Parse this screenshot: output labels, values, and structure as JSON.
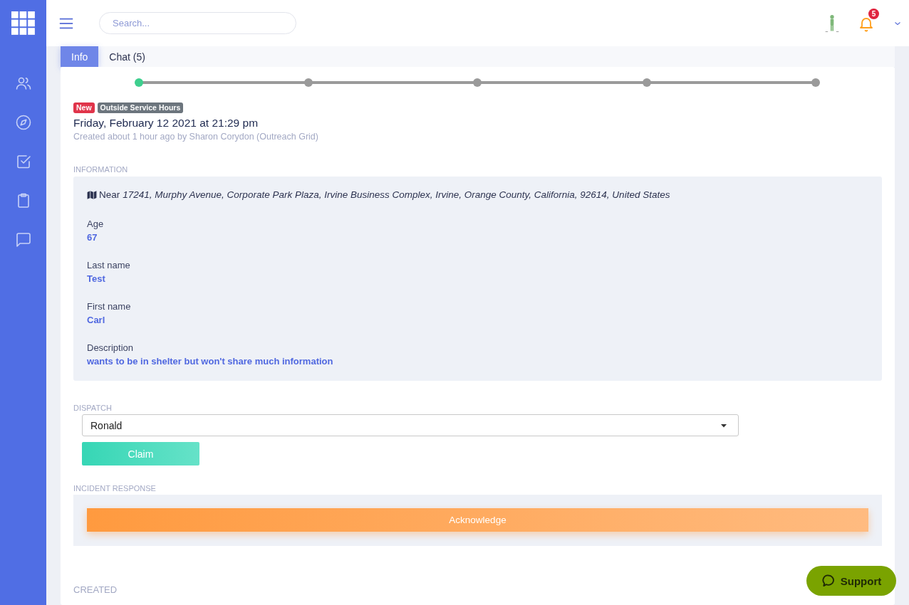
{
  "topbar": {
    "search": {
      "placeholder": "Search..."
    },
    "notifications": {
      "count": "5"
    }
  },
  "tabs": [
    {
      "label": "Info",
      "selected": true
    },
    {
      "label": "Chat (5)",
      "selected": false
    }
  ],
  "progress": {
    "steps": [
      {
        "completed": true
      },
      {
        "completed": false
      },
      {
        "completed": false
      },
      {
        "completed": false
      },
      {
        "completed": false
      }
    ]
  },
  "badges": [
    {
      "label": "New",
      "color": "#e0344a"
    },
    {
      "label": "Outside Service Hours",
      "color": "#6c757d"
    }
  ],
  "title": "Friday, February 12 2021 at 21:29 pm",
  "subtitle": "Created about 1 hour ago by Sharon Corydon (Outreach Grid)",
  "information": {
    "heading": "INFORMATION",
    "location_prefix": "Near",
    "location": "17241, Murphy Avenue, Corporate Park Plaza, Irvine Business Complex, Irvine, Orange County, California, 92614, United States",
    "fields": [
      {
        "label": "Age",
        "value": "67"
      },
      {
        "label": "Last name",
        "value": "Test"
      },
      {
        "label": "First name",
        "value": "Carl"
      },
      {
        "label": "Description",
        "value": "wants to be in shelter but won't share much information"
      }
    ]
  },
  "dispatch": {
    "heading": "DISPATCH",
    "value": "Ronald",
    "button": "Claim"
  },
  "incident_response": {
    "heading": "INCIDENT RESPONSE",
    "button": "Acknowledge"
  },
  "created": {
    "heading": "CREATED"
  },
  "support_button": "Support"
}
